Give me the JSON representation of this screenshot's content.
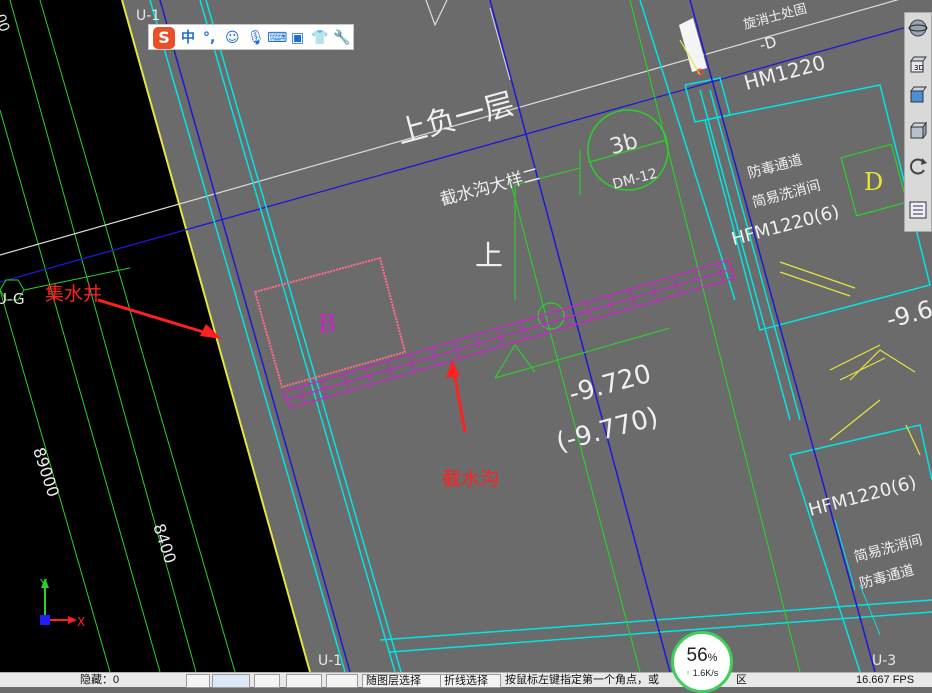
{
  "drawing": {
    "floor_label": "上负一层",
    "detail_label": "截水沟大样二",
    "up_label": "上",
    "axis_ref_num": "3b",
    "axis_ref_sheet": "DM-12",
    "room_b": "B",
    "room_d": "D",
    "door_hm": "HM1220",
    "door_hm_minus": "-D",
    "door_hfm_top": "HFM1220(6)",
    "door_hfm_bottom": "HFM1220(6)",
    "door_top_partial": "旋消士处固",
    "room_poison_1": "防毒通道",
    "room_wash_1": "简易洗消间",
    "room_wash_2": "简易洗消间",
    "room_poison_2": "防毒通道",
    "elev_main": "-9.720",
    "elev_sub": "(-9.770)",
    "elev_right": "-9.6",
    "dim_1": "89000",
    "dim_2": "8400",
    "dim_top": "00",
    "axis_ug": "U-G",
    "axis_u1_top": "U-1",
    "axis_u1_bottom": "U-1",
    "axis_u3": "U-3",
    "ucs_x": "X",
    "ucs_y": "Y"
  },
  "annotations": {
    "sump": "集水井",
    "trench": "截水沟"
  },
  "ime": {
    "logo": "S",
    "mode": "中",
    "punct": "°,"
  },
  "statusbar": {
    "hidden_label": "隐藏：0",
    "layer_select": "随图层选择",
    "polyline_select": "折线选择",
    "hint": "按鼠标左键指定第一个角点，或",
    "hint_tail": "区",
    "fps": "16.667 FPS"
  },
  "network": {
    "percent": "56",
    "percent_sign": "%",
    "speed": "1.6K/s"
  },
  "colors": {
    "background": "#6b6b6b",
    "black_area": "#000000",
    "cyan": "#00e5e5",
    "blue": "#1a1ad6",
    "green": "#2ad12a",
    "yellow": "#e6e63a",
    "magenta": "#cc22cc",
    "pink": "#ff6b8a",
    "annotation_red": "#ff2020"
  }
}
